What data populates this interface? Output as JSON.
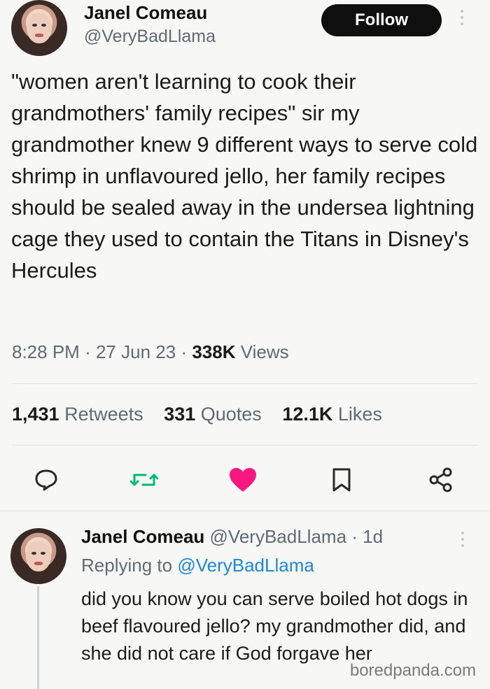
{
  "tweet": {
    "author_name": "Janel Comeau",
    "author_handle": "@VeryBadLlama",
    "follow_label": "Follow",
    "text": "\"women aren't learning to cook their grandmothers' family recipes\" sir my grandmother knew 9 different ways to serve cold shrimp in unflavoured jello, her family recipes should be sealed away in the undersea lightning cage they used to contain the Titans in Disney's Hercules",
    "time": "8:28 PM",
    "date": "27 Jun 23",
    "views_count": "338K",
    "views_label": "Views",
    "retweets_count": "1,431",
    "retweets_label": "Retweets",
    "quotes_count": "331",
    "quotes_label": "Quotes",
    "likes_count": "12.1K",
    "likes_label": "Likes",
    "separator": "·"
  },
  "actions": {
    "reply_icon": "comment-bubble",
    "retweet_icon": "retweet-arrows",
    "like_icon": "heart-filled",
    "bookmark_icon": "bookmark",
    "share_icon": "share-nodes",
    "like_color": "#f91880",
    "retweet_color": "#00ba7c"
  },
  "reply": {
    "author_name": "Janel Comeau",
    "author_handle": "@VeryBadLlama",
    "age": "1d",
    "replying_prefix": "Replying to",
    "replying_to": "@VeryBadLlama",
    "text": "did you know you can serve boiled hot dogs in beef flavoured jello? my grandmother did, and she did not care if God forgave her"
  },
  "watermark": "boredpanda.com"
}
